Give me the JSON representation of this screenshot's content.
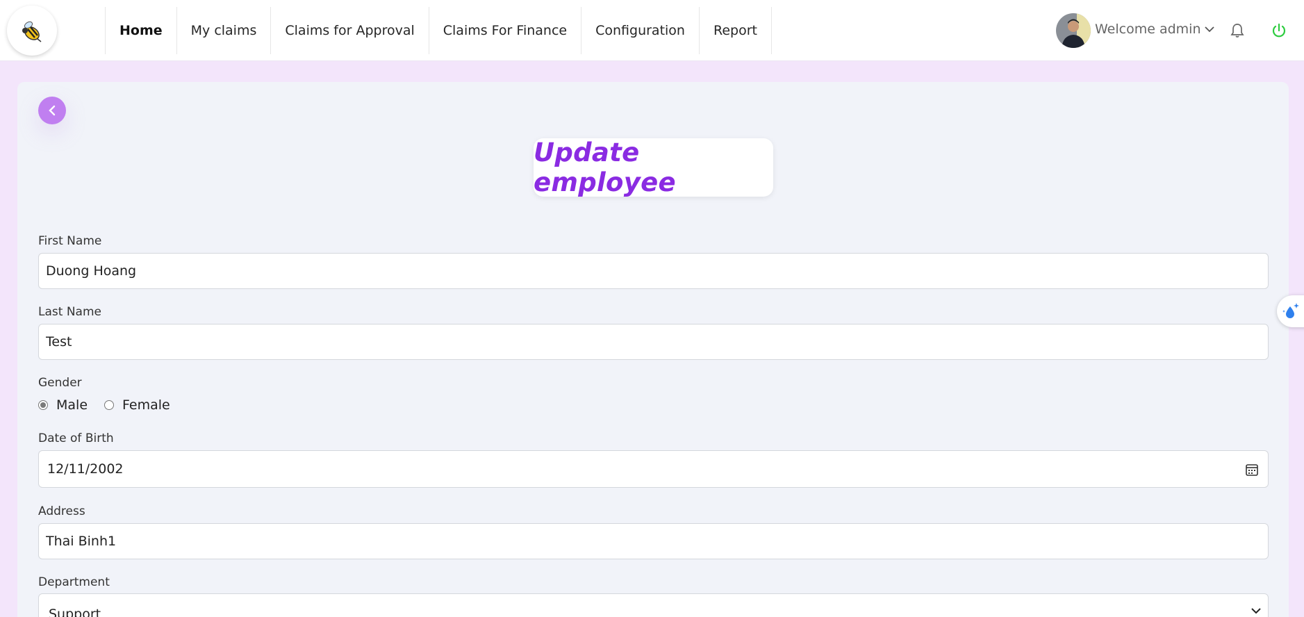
{
  "header": {
    "nav": [
      {
        "label": "Home",
        "active": true
      },
      {
        "label": "My claims",
        "active": false
      },
      {
        "label": "Claims for Approval",
        "active": false
      },
      {
        "label": "Claims For Finance",
        "active": false
      },
      {
        "label": "Configuration",
        "active": false
      },
      {
        "label": "Report",
        "active": false
      }
    ],
    "welcome_text": "Welcome admin",
    "icons": [
      "logo-bee",
      "avatar",
      "chevron-down-icon",
      "bell-icon",
      "power-icon"
    ]
  },
  "page": {
    "title": "Update employee"
  },
  "form": {
    "first_name": {
      "label": "First Name",
      "value": "Duong Hoang"
    },
    "last_name": {
      "label": "Last Name",
      "value": "Test"
    },
    "gender": {
      "label": "Gender",
      "options": [
        "Male",
        "Female"
      ],
      "selected": "Male"
    },
    "dob": {
      "label": "Date of Birth",
      "value": "12/11/2002"
    },
    "address": {
      "label": "Address",
      "value": "Thai Binh1"
    },
    "department": {
      "label": "Department",
      "value": "Support"
    }
  },
  "colors": {
    "accent": "#8a2be2",
    "back_button": "#c07ff0",
    "page_bg": "#f3e5fb",
    "power": "#2ecc40"
  }
}
